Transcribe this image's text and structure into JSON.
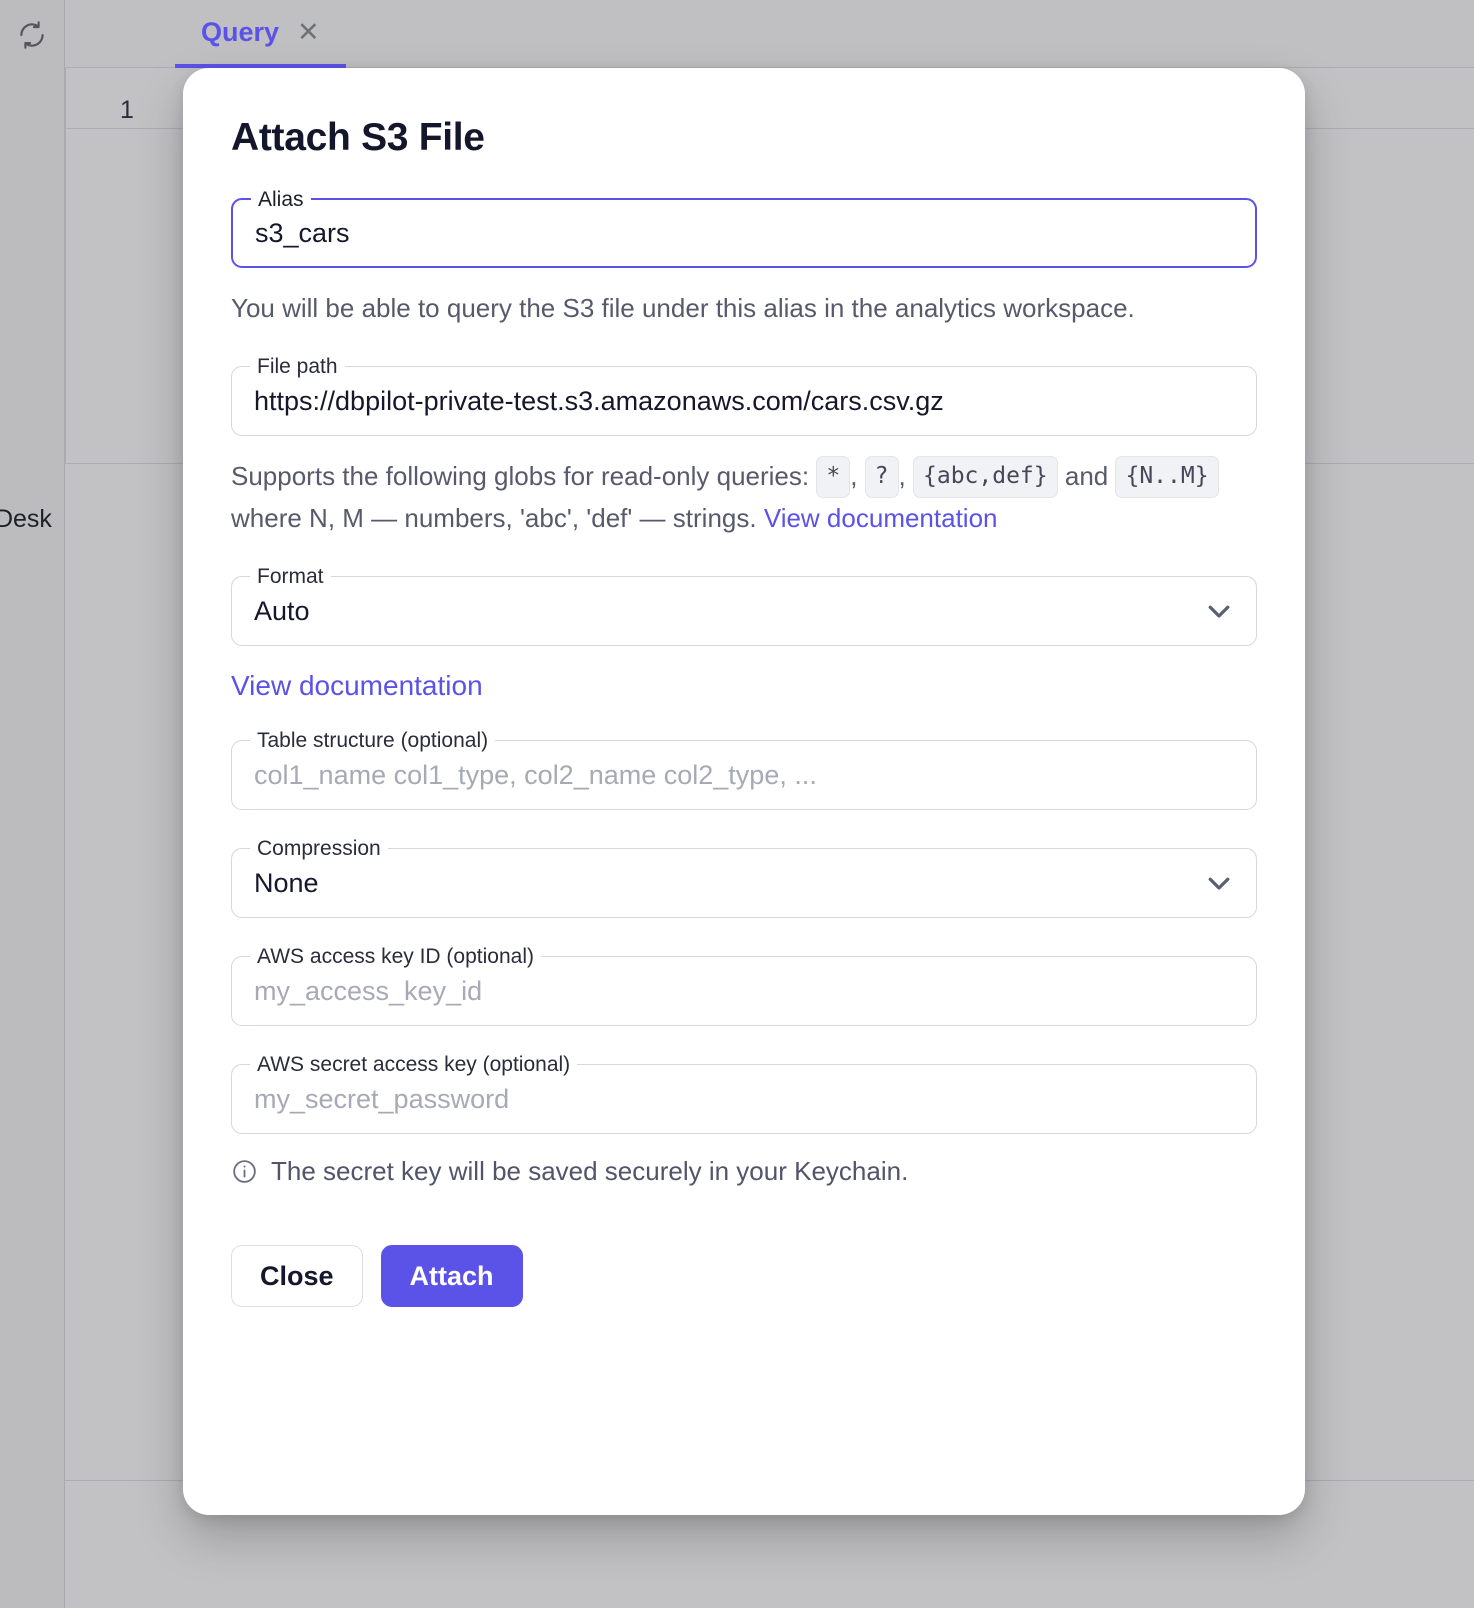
{
  "background": {
    "refresh_icon": "refresh-icon",
    "path_text": "/Desk",
    "tab": {
      "label": "Query",
      "close_icon": "close-icon"
    },
    "editor": {
      "line_number": "1"
    }
  },
  "modal": {
    "title": "Attach S3 File",
    "alias": {
      "label": "Alias",
      "value": "s3_cars",
      "helper": "You will be able to query the S3 file under this alias in the analytics workspace."
    },
    "file_path": {
      "label": "File path",
      "value": "https://dbpilot-private-test.s3.amazonaws.com/cars.csv.gz",
      "helper_part1": "Supports the following globs for read-only queries:",
      "glob_1": "*",
      "glob_sep_1": ",",
      "glob_2": "?",
      "glob_sep_2": ",",
      "glob_3": "{abc,def}",
      "helper_and": "and",
      "glob_4": "{N..M}",
      "helper_part2": "where N, M — numbers, 'abc', 'def' — strings.",
      "doc_link": "View documentation"
    },
    "format": {
      "label": "Format",
      "value": "Auto",
      "chevron_icon": "chevron-down-icon",
      "doc_link": "View documentation"
    },
    "table_structure": {
      "label": "Table structure (optional)",
      "placeholder": "col1_name col1_type, col2_name col2_type, ..."
    },
    "compression": {
      "label": "Compression",
      "value": "None",
      "chevron_icon": "chevron-down-icon"
    },
    "aws_access_key": {
      "label": "AWS access key ID (optional)",
      "placeholder": "my_access_key_id"
    },
    "aws_secret_key": {
      "label": "AWS secret access key (optional)",
      "placeholder": "my_secret_password"
    },
    "keychain_note": {
      "icon": "info-circle-icon",
      "text": "The secret key will be saved securely in your Keychain."
    },
    "footer": {
      "close_label": "Close",
      "attach_label": "Attach"
    }
  },
  "colors": {
    "accent": "#5b52e8",
    "background": "#c0c0c2",
    "modal_bg": "#ffffff",
    "text": "#15172a",
    "muted_text": "#575a6b"
  }
}
